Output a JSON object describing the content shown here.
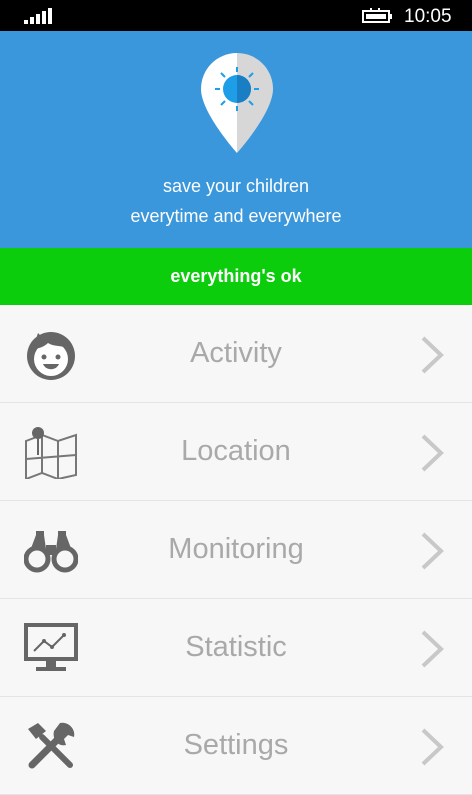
{
  "status_bar": {
    "time": "10:05",
    "signal_icon": "signal-icon",
    "battery_icon": "battery-charging-icon"
  },
  "hero": {
    "logo_icon": "location-pin-icon",
    "tagline_line1": "save your children",
    "tagline_line2": "everytime and everywhere",
    "background_color": "#3a97db"
  },
  "status_banner": {
    "text": "everything's ok",
    "color": "#0ccd0c"
  },
  "menu": {
    "items": [
      {
        "label": "Activity",
        "icon": "child-face-icon"
      },
      {
        "label": "Location",
        "icon": "map-icon"
      },
      {
        "label": "Monitoring",
        "icon": "binoculars-icon"
      },
      {
        "label": "Statistic",
        "icon": "chart-monitor-icon"
      },
      {
        "label": "Settings",
        "icon": "tools-icon"
      }
    ],
    "chevron_icon": "chevron-right-icon"
  }
}
